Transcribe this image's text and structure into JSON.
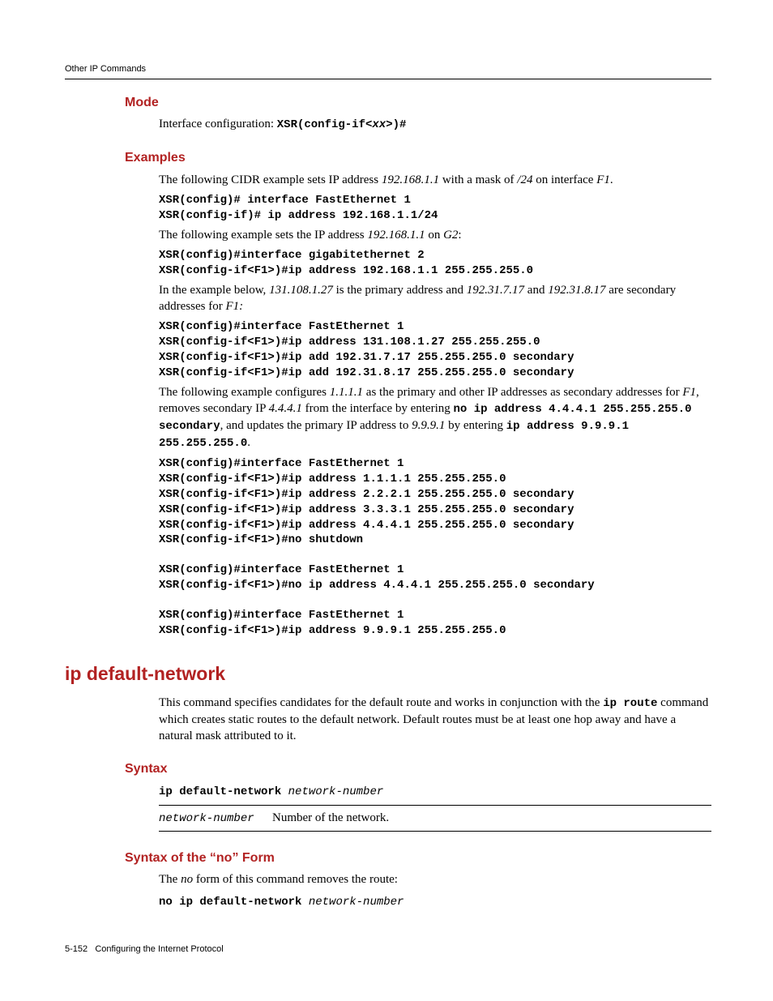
{
  "header": {
    "breadcrumb": "Other IP Commands"
  },
  "section_mode": {
    "title": "Mode",
    "text_prefix": "Interface configuration: ",
    "code": "XSR(config-if<",
    "code_italic": "xx",
    "code_suffix": ">)#"
  },
  "section_examples": {
    "title": "Examples",
    "ex1_prefix": "The following CIDR example sets IP address ",
    "ex1_ip": "192.168.1.1",
    "ex1_mid": " with a mask of ",
    "ex1_mask": "/24",
    "ex1_mid2": " on interface ",
    "ex1_if": "F1",
    "ex1_suffix": ".",
    "code1": "XSR(config)# interface FastEthernet 1\nXSR(config-if)# ip address 192.168.1.1/24",
    "ex2_prefix": "The following example sets the IP address ",
    "ex2_ip": "192.168.1.1",
    "ex2_mid": " on ",
    "ex2_if": "G2",
    "ex2_suffix": ":",
    "code2": "XSR(config)#interface gigabitethernet 2\nXSR(config-if<F1>)#ip address 192.168.1.1 255.255.255.0",
    "ex3_prefix": "In the example below, ",
    "ex3_ip1": "131.108.1.27",
    "ex3_mid1": " is the primary address and ",
    "ex3_ip2": "192.31.7.17",
    "ex3_mid2": " and ",
    "ex3_ip3": "192.31.8.17",
    "ex3_mid3": " are secondary addresses for ",
    "ex3_if": "F1:",
    "code3": "XSR(config)#interface FastEthernet 1\nXSR(config-if<F1>)#ip address 131.108.1.27 255.255.255.0\nXSR(config-if<F1>)#ip add 192.31.7.17 255.255.255.0 secondary\nXSR(config-if<F1>)#ip add 192.31.8.17 255.255.255.0 secondary",
    "ex4_prefix": "The following example configures ",
    "ex4_ip1": "1.1.1.1",
    "ex4_mid1": " as the primary and other IP addresses as secondary addresses for ",
    "ex4_if": "F1",
    "ex4_mid2": ", removes secondary IP ",
    "ex4_ip2": "4.4.4.1",
    "ex4_mid3": " from the interface by entering ",
    "ex4_code1": "no ip address 4.4.4.1 255.255.255.0 secondary",
    "ex4_mid4": ", and updates the primary IP address to ",
    "ex4_ip3": "9.9.9.1",
    "ex4_mid5": " by entering ",
    "ex4_code2": "ip address 9.9.9.1 255.255.255.0",
    "ex4_suffix": ".",
    "code4a": "XSR(config)#interface FastEthernet 1\nXSR(config-if<F1>)#ip address 1.1.1.1 255.255.255.0\nXSR(config-if<F1>)#ip address 2.2.2.1 255.255.255.0 secondary\nXSR(config-if<F1>)#ip address 3.3.3.1 255.255.255.0 secondary\nXSR(config-if<F1>)#ip address 4.4.4.1 255.255.255.0 secondary\nXSR(config-if<F1>)#no shutdown",
    "code4b": "XSR(config)#interface FastEthernet 1\nXSR(config-if<F1>)#no ip address 4.4.4.1 255.255.255.0 secondary",
    "code4c": "XSR(config)#interface FastEthernet 1\nXSR(config-if<F1>)#ip address 9.9.9.1 255.255.255.0"
  },
  "section_default": {
    "title": "ip default-network",
    "para_prefix": "This command specifies candidates for the default route and works in conjunction with the ",
    "para_code": "ip route",
    "para_suffix": " command which creates static routes to the default network. Default routes must be at least one hop away and have a natural mask attributed to it."
  },
  "section_syntax": {
    "title": "Syntax",
    "cmd": "ip default-network ",
    "arg": "network-number",
    "table_arg": "network-number",
    "table_desc": "Number of the network."
  },
  "section_noform": {
    "title": "Syntax of the “no” Form",
    "para_prefix": "The ",
    "para_italic": "no",
    "para_suffix": " form of this command removes the route:",
    "cmd": "no ip default-network ",
    "arg": "network-number"
  },
  "footer": {
    "page": "5-152",
    "label": "Configuring the Internet Protocol"
  }
}
